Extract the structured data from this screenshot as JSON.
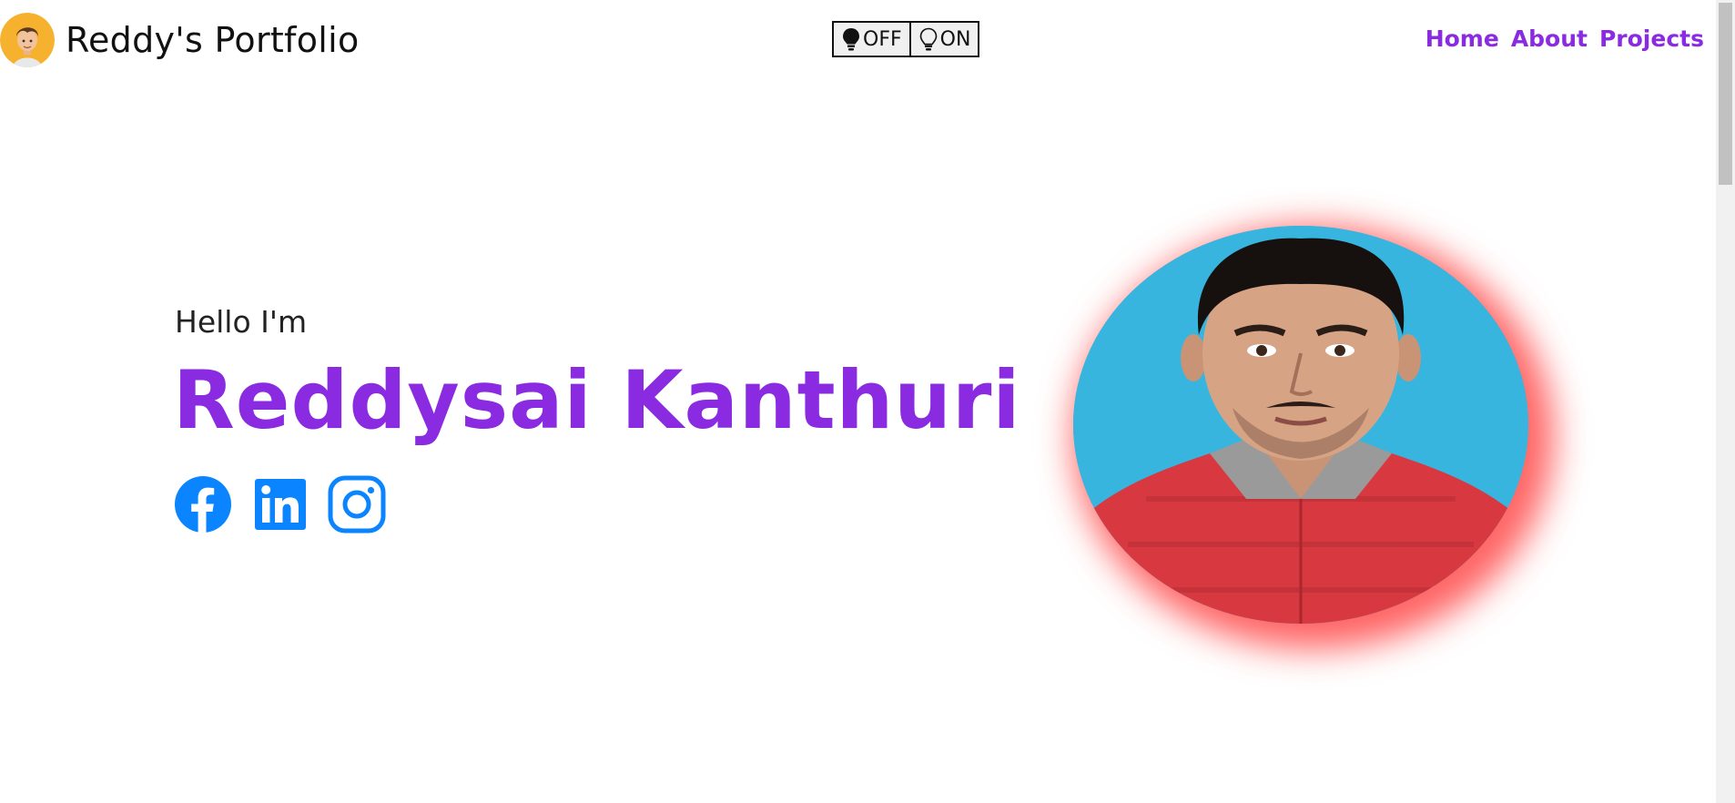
{
  "header": {
    "brand_title": "Reddy's Portfolio",
    "avatar_icon": "cartoon-face-icon"
  },
  "theme_toggle": {
    "off_label": "OFF",
    "on_label": "ON",
    "off_icon": "bulb-filled-icon",
    "on_icon": "bulb-outline-icon"
  },
  "nav": {
    "items": [
      {
        "label": "Home"
      },
      {
        "label": "About"
      },
      {
        "label": "Projects"
      }
    ]
  },
  "hero": {
    "greeting": "Hello I'm",
    "name": "Reddysai Kanthuri",
    "socials": [
      {
        "icon": "facebook-icon"
      },
      {
        "icon": "linkedin-icon"
      },
      {
        "icon": "instagram-icon"
      }
    ],
    "photo": "profile-photo"
  },
  "colors": {
    "accent": "#8a2be2",
    "social_blue": "#0a84ff",
    "photo_glow": "#ff2828",
    "photo_background": "#37b5de"
  }
}
